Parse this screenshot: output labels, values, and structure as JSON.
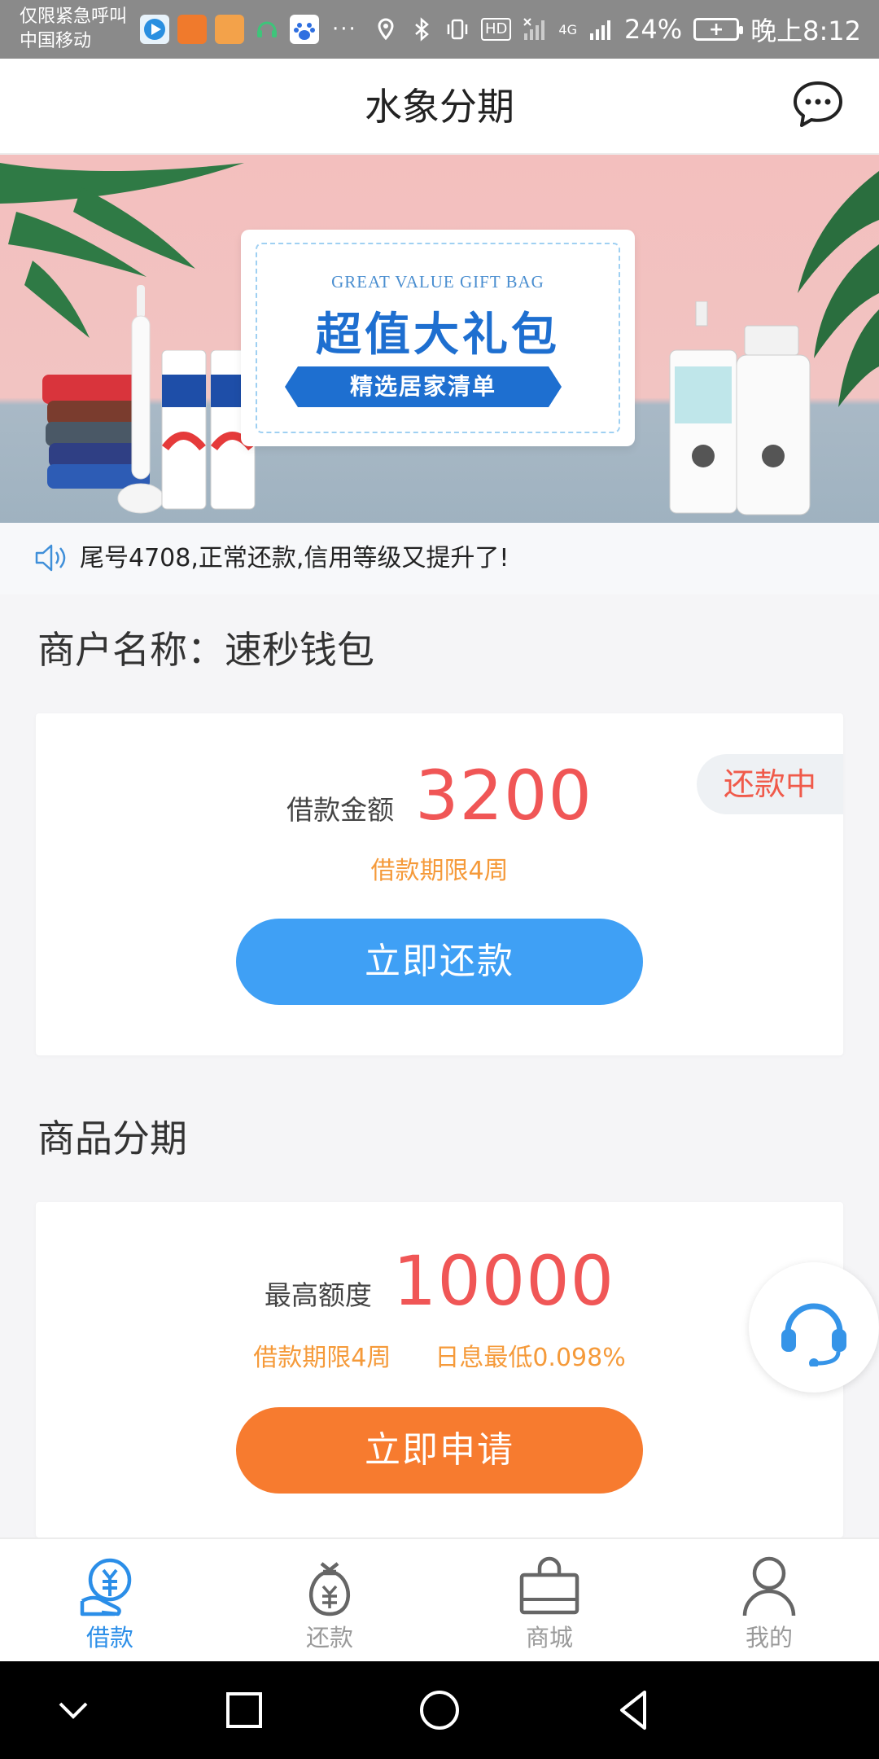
{
  "status_bar": {
    "carrier_line1": "仅限紧急呼叫",
    "carrier_line2": "中国移动",
    "more": "···",
    "hd": "HD",
    "network": "4G",
    "battery_percent": "24%",
    "time": "晚上8:12"
  },
  "header": {
    "title": "水象分期",
    "chat_icon": "chat-bubble-icon"
  },
  "banner": {
    "en_title": "GREAT VALUE GIFT BAG",
    "cn_title": "超值大礼包",
    "ribbon": "精选居家清单"
  },
  "notice": {
    "text": "尾号4708,正常还款,信用等级又提升了!"
  },
  "merchant": {
    "title": "商户名称：速秒钱包",
    "amount_label": "借款金额",
    "amount_value": "3200",
    "term": "借款期限4周",
    "status": "还款中",
    "button": "立即还款"
  },
  "product": {
    "title": "商品分期",
    "limit_label": "最高额度",
    "limit_value": "10000",
    "term": "借款期限4周",
    "rate": "日息最低0.098%",
    "button": "立即申请"
  },
  "tabbar": {
    "items": [
      {
        "label": "借款",
        "icon": "loan-icon",
        "active": true
      },
      {
        "label": "还款",
        "icon": "money-bag-icon",
        "active": false
      },
      {
        "label": "商城",
        "icon": "shopping-bag-icon",
        "active": false
      },
      {
        "label": "我的",
        "icon": "person-icon",
        "active": false
      }
    ]
  },
  "colors": {
    "accent_blue": "#3fa0f5",
    "accent_orange": "#f77b2f",
    "amount_red": "#f05656",
    "term_orange": "#f59a3a"
  }
}
